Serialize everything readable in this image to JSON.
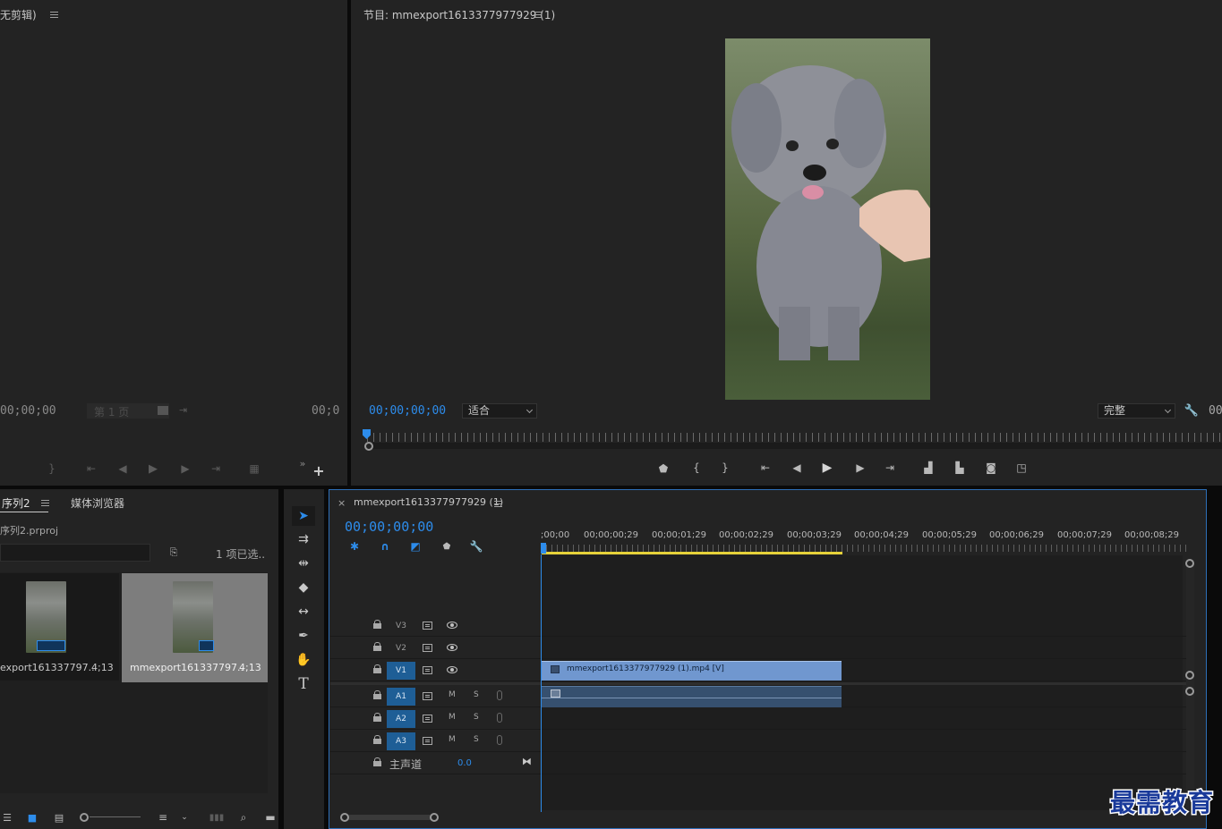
{
  "source_monitor": {
    "title": "无剪辑)",
    "timecode_left": "00;00;00",
    "page_label": "第 1 页",
    "timecode_right": "00;0"
  },
  "program_monitor": {
    "title": "节目: mmexport1613377977929 (1)",
    "timecode": "00;00;00;00",
    "fit_dropdown": "适合",
    "quality_dropdown": "完整",
    "timecode_right": "00"
  },
  "project": {
    "tab_active": "序列2",
    "tab_media_browser": "媒体浏览器",
    "project_file": "序列2.prproj",
    "selection_count": "1 项已选..",
    "items": [
      {
        "name": "export161337797..",
        "duration": "4;13"
      },
      {
        "name": "mmexport161337797..",
        "duration": "4;13"
      }
    ]
  },
  "timeline": {
    "close": "×",
    "sequence_name": "mmexport1613377977929 (1)",
    "timecode": "00;00;00;00",
    "ruler_labels": [
      ";00;00",
      "00;00;00;29",
      "00;00;01;29",
      "00;00;02;29",
      "00;00;03;29",
      "00;00;04;29",
      "00;00;05;29",
      "00;00;06;29",
      "00;00;07;29",
      "00;00;08;29"
    ],
    "tracks": {
      "v3": "V3",
      "v2": "V2",
      "v1": "V1",
      "a1": "A1",
      "a2": "A2",
      "a3": "A3",
      "m": "M",
      "s": "S"
    },
    "master_label": "主声道",
    "master_value": "0.0",
    "video_clip_label": "mmexport1613377977929 (1).mp4 [V]"
  },
  "watermark": "最需教育",
  "colors": {
    "accent_blue": "#2d8ceb",
    "clip_video": "#7097cf",
    "clip_audio": "#36506f",
    "work_area": "#e6d23a"
  }
}
